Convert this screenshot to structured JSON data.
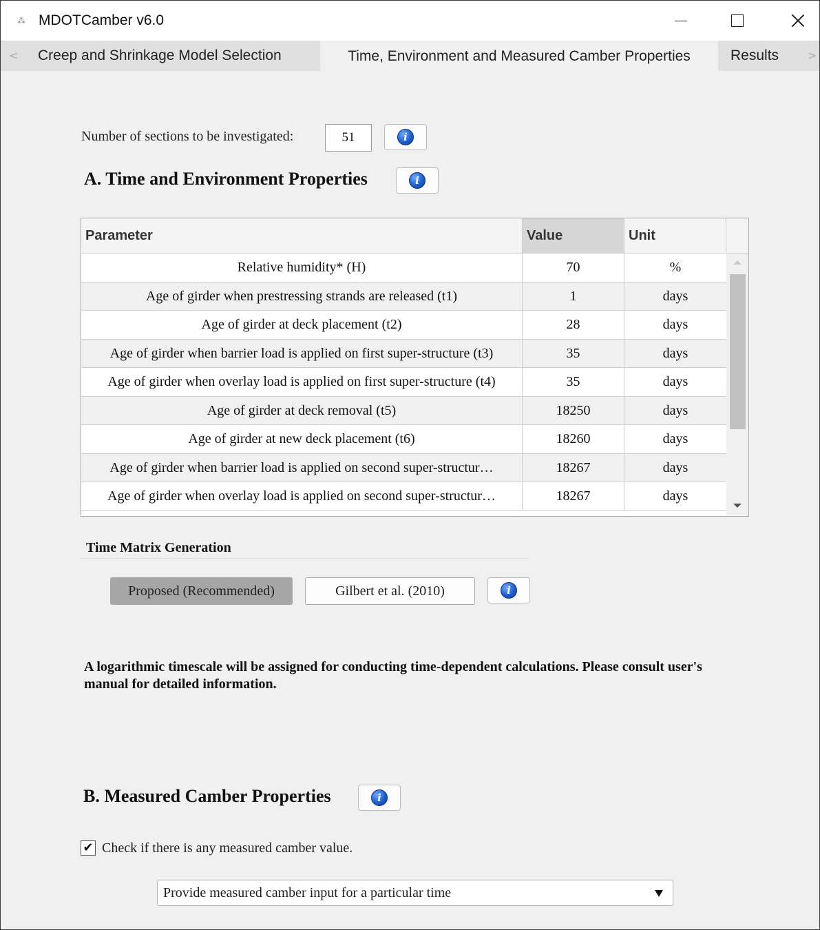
{
  "window": {
    "title": "MDOTCamber v6.0",
    "app_icon": "matlab-icon",
    "app_icon_glyph": "⁂"
  },
  "tabs": [
    {
      "label": "Creep and Shrinkage Model Selection",
      "active": false
    },
    {
      "label": "Time, Environment and Measured Camber Properties",
      "active": true
    },
    {
      "label": "Results",
      "active": false
    }
  ],
  "sections": {
    "label": "Number of sections to be investigated:",
    "value": "51"
  },
  "section_a": {
    "title": "A. Time and Environment Properties"
  },
  "table": {
    "columns": [
      "Parameter",
      "Value",
      "Unit"
    ],
    "rows": [
      {
        "param": "Relative humidity* (H)",
        "value": "70",
        "unit": "%"
      },
      {
        "param": "Age of girder when prestressing strands are released (t1)",
        "value": "1",
        "unit": "days"
      },
      {
        "param": "Age of girder at deck placement (t2)",
        "value": "28",
        "unit": "days"
      },
      {
        "param": "Age of girder when barrier load is applied on first super-structure (t3)",
        "value": "35",
        "unit": "days"
      },
      {
        "param": "Age of girder when overlay load is applied on first super-structure (t4)",
        "value": "35",
        "unit": "days"
      },
      {
        "param": "Age of girder at deck removal (t5)",
        "value": "18250",
        "unit": "days"
      },
      {
        "param": "Age of girder at new deck placement (t6)",
        "value": "18260",
        "unit": "days"
      },
      {
        "param": "Age of girder when barrier load is applied on second super-structur…",
        "value": "18267",
        "unit": "days"
      },
      {
        "param": "Age of girder when overlay load is applied on second super-structur…",
        "value": "18267",
        "unit": "days"
      }
    ]
  },
  "time_matrix": {
    "title": "Time Matrix Generation",
    "options": [
      "Proposed (Recommended)",
      "Gilbert et al. (2010)"
    ],
    "selected": "Proposed (Recommended)"
  },
  "note": "A logarithmic timescale will be assigned for conducting time-dependent calculations. Please consult user's manual for detailed information.",
  "section_b": {
    "title": "B. Measured Camber Properties",
    "checkbox_label": "Check if there is any measured camber value.",
    "checked": true,
    "dropdown_value": "Provide measured camber input for a particular time"
  },
  "colors": {
    "info_blue": "#1d5fd0",
    "selected_button": "#a6a6a6"
  }
}
